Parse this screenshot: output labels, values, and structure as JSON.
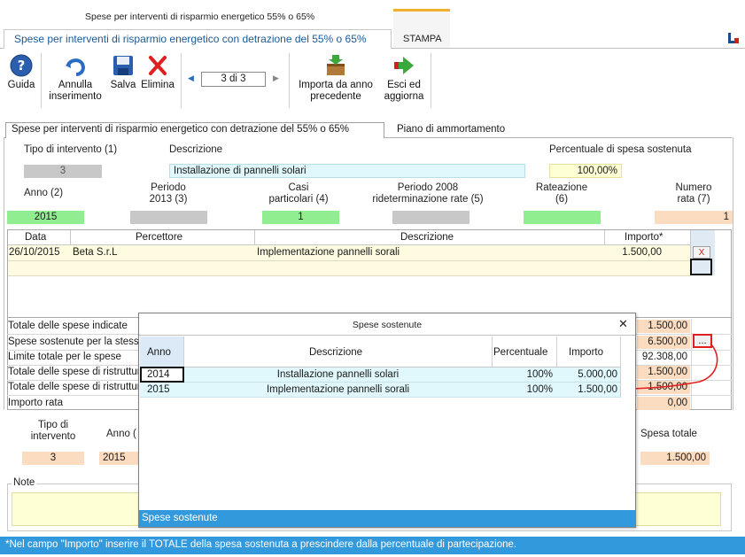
{
  "window": {
    "title": "Spese per interventi di risparmio energetico 55% o 65%",
    "main_tab": "Spese per interventi di risparmio energetico con detrazione del 55% o 65%",
    "stampa_tab": "STAMPA"
  },
  "toolbar": {
    "guida": "Guida",
    "annulla": [
      "Annulla",
      "inserimento"
    ],
    "salva": "Salva",
    "elimina": "Elimina",
    "nav": "3 di 3",
    "importa": [
      "Importa da anno",
      "precedente"
    ],
    "esci": [
      "Esci ed",
      "aggiorna"
    ]
  },
  "subtabs": {
    "active": "Spese per interventi di risparmio energetico con detrazione del 55% o 65%",
    "other": "Piano di ammortamento"
  },
  "form": {
    "tipo_label": "Tipo di intervento (1)",
    "tipo_value": "3",
    "descrizione_label": "Descrizione",
    "descrizione_value": "Installazione di pannelli solari",
    "percentuale_label": "Percentuale di spesa sostenuta",
    "percentuale_value": "100,00%",
    "anno_label": "Anno (2)",
    "anno_value": "2015",
    "periodo2013_label": [
      "Periodo",
      "2013 (3)"
    ],
    "casi_label": [
      "Casi",
      "particolari (4)"
    ],
    "casi_value": "1",
    "periodo2008_label": [
      "Periodo 2008",
      "rideterminazione rate (5)"
    ],
    "rateazione_label": [
      "Rateazione",
      "(6)"
    ],
    "numero_label": [
      "Numero",
      "rata (7)"
    ],
    "numero_value": "1"
  },
  "grid": {
    "headers": [
      "Data",
      "Percettore",
      "Descrizione",
      "Importo*"
    ],
    "rows": [
      {
        "data": "26/10/2015",
        "percettore": "Beta S.r.L",
        "descrizione": "Implementazione pannelli sorali",
        "importo": "1.500,00",
        "btn": "X"
      }
    ]
  },
  "totals": {
    "rows": [
      {
        "label": "Totale delle spese indicate",
        "value": "1.500,00"
      },
      {
        "label": "Spese sostenute per la stessa",
        "value": "6.500,00"
      },
      {
        "label": "Limite totale per le spese",
        "value": "92.308,00"
      },
      {
        "label": "Totale delle spese di ristrutturazione",
        "value": "1.500,00"
      },
      {
        "label": "Totale delle spese di ristrutturazione",
        "value": "1.500,00"
      },
      {
        "label": "Importo rata",
        "value": "0,00"
      }
    ],
    "dots_btn": "..."
  },
  "bottom": {
    "tipo_label": [
      "Tipo di",
      "intervento"
    ],
    "tipo_value": "3",
    "anno_label": "Anno (",
    "anno_value": "2015",
    "spesa_label": "Spesa totale",
    "spesa_value": "1.500,00",
    "note_label": "Note"
  },
  "modal": {
    "title": "Spese sostenute",
    "close": "✕",
    "headers": [
      "Anno",
      "Descrizione",
      "Percentuale",
      "Importo"
    ],
    "rows": [
      {
        "anno": "2014",
        "descrizione": "Installazione pannelli solari",
        "percentuale": "100%",
        "importo": "5.000,00"
      },
      {
        "anno": "2015",
        "descrizione": "Implementazione pannelli sorali",
        "percentuale": "100%",
        "importo": "1.500,00"
      }
    ],
    "footer": "Spese sostenute"
  },
  "status_bar": "*Nel campo \"Importo\" inserire il TOTALE della spesa sostenuta a prescindere dalla percentuale di partecipazione.",
  "colors": {
    "accent_blue": "#3399dd",
    "field_green": "#90ee90",
    "field_peach": "#fcdcc0",
    "field_gray": "#c8c8c8",
    "highlight_red": "#e02020",
    "stampa_orange": "#f0b030"
  }
}
